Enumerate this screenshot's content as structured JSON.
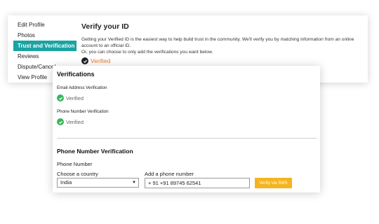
{
  "sidebar": {
    "items": [
      {
        "label": "Edit Profile",
        "active": false
      },
      {
        "label": "Photos",
        "active": false
      },
      {
        "label": "Trust and Verification",
        "active": true
      },
      {
        "label": "Reviews",
        "active": false
      },
      {
        "label": "Dispute/Cancel",
        "active": false
      },
      {
        "label": "View Profile",
        "active": false
      }
    ]
  },
  "verify": {
    "title": "Verify your ID",
    "description_line1": "Getting your Verified ID is the easiest way to help build trust in the community. We'll verify you by matching information from an online account to an official ID.",
    "description_line2": "Or, you can choose to only add the verifications you want below.",
    "status": "Verified",
    "status_color": "#e2772a",
    "status_icon": "check-circle-icon"
  },
  "verifications": {
    "title": "Verifications",
    "email": {
      "label": "Email Address Verification",
      "status": "Verified",
      "icon": "check-circle-icon"
    },
    "phone": {
      "label": "Phone Number Verification",
      "status": "Verified",
      "icon": "check-circle-icon"
    }
  },
  "phone_verification": {
    "title": "Phone Number Verification",
    "subtitle": "Phone Number",
    "country_label": "Choose a country",
    "country_value": "India",
    "phone_label": "Add a phone number",
    "phone_value": "+ 91 +91 89745 62541",
    "sms_button": "Verify via SMS",
    "button_color": "#f5b41f"
  },
  "colors": {
    "accent": "#1aa3a3",
    "success": "#3bb35a"
  }
}
